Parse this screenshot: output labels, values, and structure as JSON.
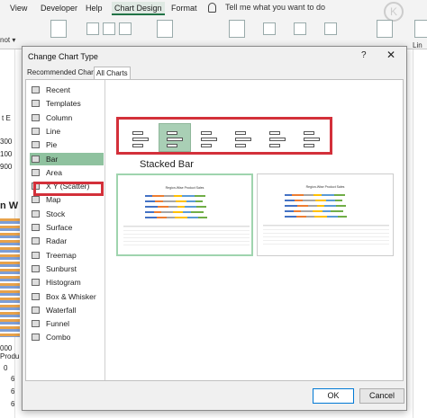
{
  "ribbon": {
    "tabs": [
      {
        "label": "View"
      },
      {
        "label": "Developer"
      },
      {
        "label": "Help"
      },
      {
        "label": "Chart Design"
      },
      {
        "label": "Format"
      }
    ],
    "tell_me": "Tell me what you want to do",
    "left_dropdown": "not ▾",
    "right_label": "Lin"
  },
  "sheet": {
    "partial_texts": [
      "t E",
      "300",
      "100",
      "900",
      "n W",
      "000",
      "Produ",
      "0",
      "6",
      "6",
      "6"
    ]
  },
  "dialog": {
    "title": "Change Chart Type",
    "help": "?",
    "close": "✕",
    "tabs": [
      {
        "label": "Recommended Charts"
      },
      {
        "label": "All Charts",
        "active": true
      }
    ],
    "chart_types": [
      {
        "label": "Recent",
        "icon": "recent-icon"
      },
      {
        "label": "Templates",
        "icon": "templates-icon"
      },
      {
        "label": "Column",
        "icon": "column-chart-icon"
      },
      {
        "label": "Line",
        "icon": "line-chart-icon"
      },
      {
        "label": "Pie",
        "icon": "pie-chart-icon"
      },
      {
        "label": "Bar",
        "icon": "bar-chart-icon",
        "selected": true
      },
      {
        "label": "Area",
        "icon": "area-chart-icon"
      },
      {
        "label": "X Y (Scatter)",
        "icon": "scatter-chart-icon"
      },
      {
        "label": "Map",
        "icon": "map-chart-icon"
      },
      {
        "label": "Stock",
        "icon": "stock-chart-icon"
      },
      {
        "label": "Surface",
        "icon": "surface-chart-icon"
      },
      {
        "label": "Radar",
        "icon": "radar-chart-icon"
      },
      {
        "label": "Treemap",
        "icon": "treemap-chart-icon"
      },
      {
        "label": "Sunburst",
        "icon": "sunburst-chart-icon"
      },
      {
        "label": "Histogram",
        "icon": "histogram-chart-icon"
      },
      {
        "label": "Box & Whisker",
        "icon": "box-whisker-chart-icon"
      },
      {
        "label": "Waterfall",
        "icon": "waterfall-chart-icon"
      },
      {
        "label": "Funnel",
        "icon": "funnel-chart-icon"
      },
      {
        "label": "Combo",
        "icon": "combo-chart-icon"
      }
    ],
    "subtypes": [
      {
        "icon": "clustered-bar-icon"
      },
      {
        "icon": "stacked-bar-icon",
        "selected": true
      },
      {
        "icon": "100-stacked-bar-icon"
      },
      {
        "icon": "3d-clustered-bar-icon"
      },
      {
        "icon": "3d-stacked-bar-icon"
      },
      {
        "icon": "3d-100-stacked-bar-icon"
      }
    ],
    "subtype_title": "Stacked Bar",
    "previews": [
      {
        "title": "Region-Wise Product Sales",
        "selected": true
      },
      {
        "title": "Region-Wise Product Sales",
        "selected": false
      }
    ],
    "series_colors": [
      "#4472c4",
      "#ed7d31",
      "#a5a5a5",
      "#ffc000",
      "#5b9bd5",
      "#70ad47"
    ],
    "ok_label": "OK",
    "cancel_label": "Cancel"
  }
}
